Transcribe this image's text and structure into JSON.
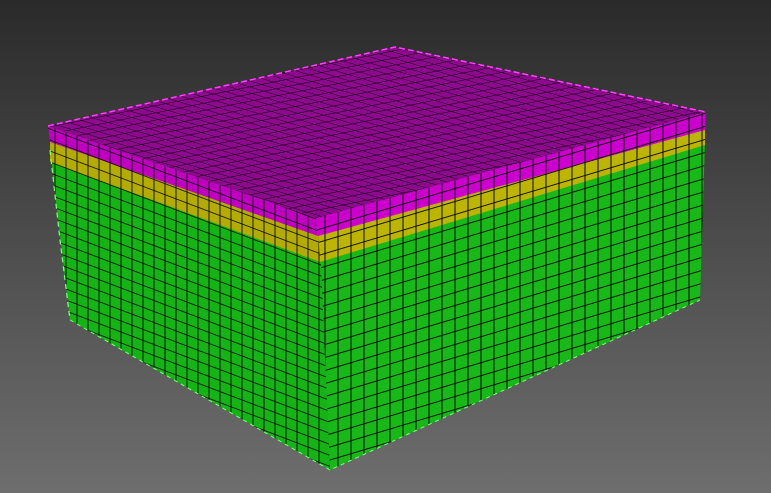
{
  "viewport": {
    "background_top": "#2a2a2a",
    "background_bottom": "#6e6e6e"
  },
  "model": {
    "type": "layered-hex-mesh-block",
    "layers": [
      {
        "name": "top-layer",
        "color": "#b400b4",
        "top_color": "#8a0a8a"
      },
      {
        "name": "middle-layer",
        "color": "#b8b000"
      },
      {
        "name": "base-layer",
        "color": "#14b414"
      }
    ],
    "edge_highlight_top": "#ff40ff",
    "edge_highlight_side": "#7dff7d",
    "grid_line_color": "#000000"
  }
}
